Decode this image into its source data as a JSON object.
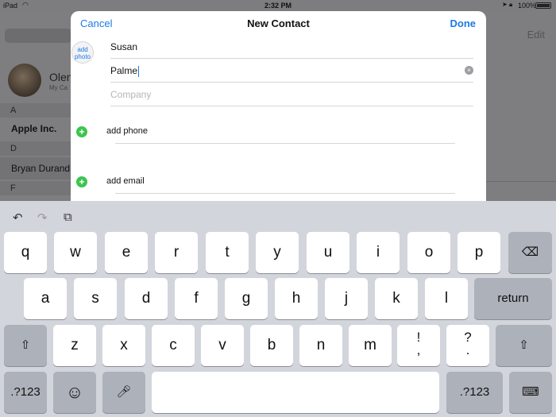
{
  "status_bar": {
    "carrier": "iPad",
    "time": "2:32 PM",
    "battery": "100%"
  },
  "background": {
    "edit_label": "Edit",
    "my_card_name": "Olen",
    "my_card_sub": "My Ca",
    "sections": [
      {
        "letter": "A"
      },
      {
        "letter": "D"
      },
      {
        "letter": "F"
      }
    ],
    "contacts": [
      "Apple Inc.",
      "Bryan Durand"
    ]
  },
  "modal": {
    "cancel": "Cancel",
    "title": "New Contact",
    "done": "Done",
    "add_photo": "add photo",
    "first_name": "Susan",
    "last_name": "Palme",
    "company_placeholder": "Company",
    "add_phone": "add phone",
    "add_email": "add email"
  },
  "keyboard": {
    "row1": [
      "q",
      "w",
      "e",
      "r",
      "t",
      "y",
      "u",
      "i",
      "o",
      "p"
    ],
    "row2": [
      "a",
      "s",
      "d",
      "f",
      "g",
      "h",
      "j",
      "k",
      "l"
    ],
    "row3": [
      "z",
      "x",
      "c",
      "v",
      "b",
      "n",
      "m"
    ],
    "return_label": "return",
    "numbers_label": ".?123",
    "exclam_top": "!",
    "exclam_bottom": ",",
    "question_top": "?",
    "question_bottom": "."
  }
}
